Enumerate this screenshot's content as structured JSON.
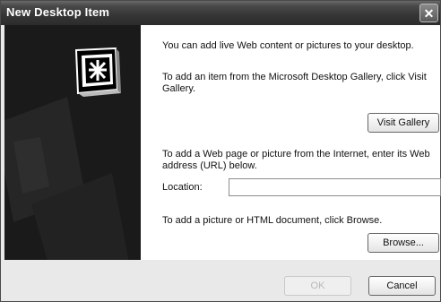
{
  "window": {
    "title": "New Desktop Item"
  },
  "intro": "You can add live Web content or pictures to your desktop.",
  "gallery": {
    "line1": "To add an item from the Microsoft Desktop Gallery, click Visit",
    "line2": "Gallery.",
    "button": "Visit Gallery"
  },
  "web": {
    "line1": "To add a Web page or picture from the Internet, enter its Web",
    "line2": "address (URL) below.",
    "location_label": "Location:",
    "location_value": ""
  },
  "browse": {
    "text": "To add a picture or HTML document, click Browse.",
    "button": "Browse..."
  },
  "footer": {
    "ok": "OK",
    "cancel": "Cancel"
  }
}
